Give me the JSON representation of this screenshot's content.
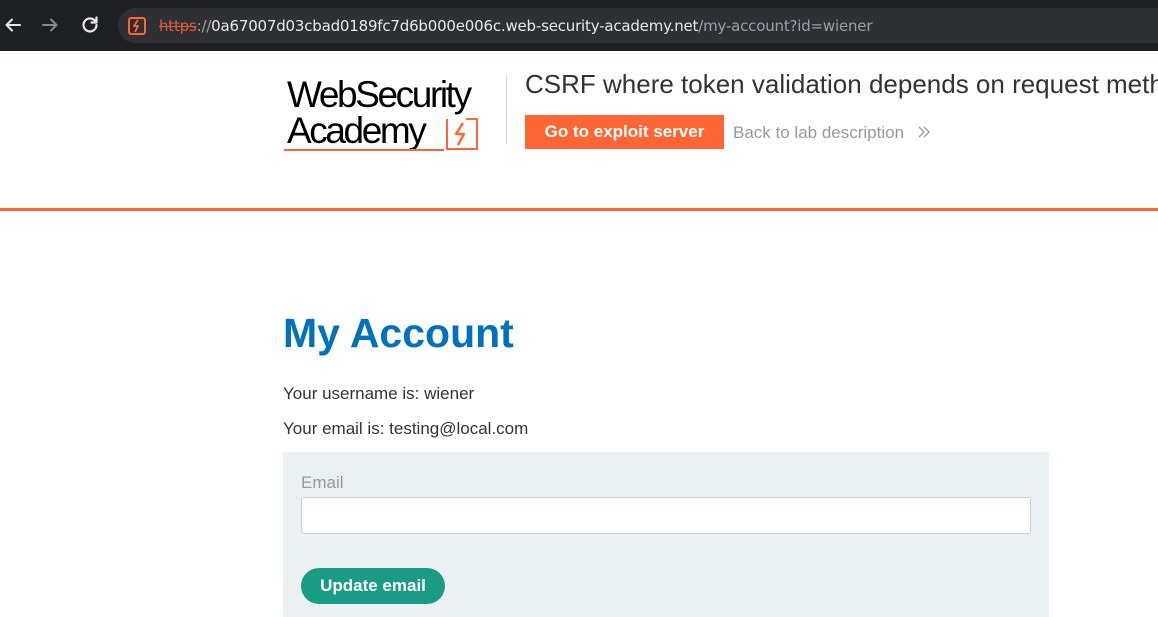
{
  "browser": {
    "url_scheme": "https",
    "url_sep": "://",
    "url_host": "0a67007d03cbad0189fc7d6b000e006c.web-security-academy.net",
    "url_path": "/my-account?id=wiener"
  },
  "header": {
    "logo_line1": "WebSecurity",
    "logo_line2": "Academy",
    "lab_title": "CSRF where token validation depends on request method",
    "exploit_button": "Go to exploit server",
    "back_link": "Back to lab description"
  },
  "main": {
    "title": "My Account",
    "username_line": "Your username is: wiener",
    "email_line": "Your email is: testing@local.com",
    "form": {
      "email_label": "Email",
      "email_value": "",
      "update_button": "Update email"
    }
  },
  "colors": {
    "accent": "#ff6633",
    "title_blue": "#0071bc",
    "button_green": "#1a9b86",
    "panel_bg": "#ebf0f2"
  }
}
